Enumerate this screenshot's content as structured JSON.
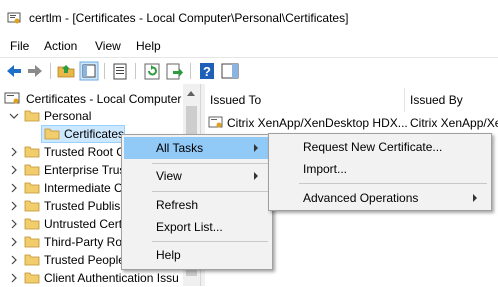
{
  "window": {
    "title": "certlm - [Certificates - Local Computer\\Personal\\Certificates]"
  },
  "menubar": {
    "items": [
      "File",
      "Action",
      "View",
      "Help"
    ]
  },
  "toolbar": {
    "buttons": [
      "back-icon",
      "forward-icon",
      "up-folder-icon",
      "show-hide-tree-icon",
      "properties-icon",
      "refresh-icon",
      "export-list-icon",
      "help-icon",
      "show-action-pane-icon"
    ]
  },
  "tree": {
    "root": "Certificates - Local Computer",
    "personal": "Personal",
    "certificates": "Certificates",
    "items": [
      "Trusted Root C",
      "Enterprise Trus",
      "Intermediate C",
      "Trusted Publis",
      "Untrusted Certi",
      "Third-Party Ro",
      "Trusted People",
      "Client Authentication Issu"
    ]
  },
  "list": {
    "columns": [
      "Issued To",
      "Issued By"
    ],
    "rows": [
      {
        "issued_to": "Citrix XenApp/XenDesktop HDX...",
        "issued_by": "Citrix XenApp/XenDesktop"
      }
    ]
  },
  "context_menu": {
    "items": [
      {
        "label": "All Tasks",
        "submenu": true,
        "highlighted": true
      },
      {
        "label": "View",
        "submenu": true
      },
      {
        "label": "Refresh"
      },
      {
        "label": "Export List..."
      },
      {
        "label": "Help"
      }
    ]
  },
  "submenu": {
    "items": [
      {
        "label": "Request New Certificate..."
      },
      {
        "label": "Import..."
      },
      {
        "label": "Advanced Operations",
        "submenu": true
      }
    ]
  },
  "colors": {
    "selection": "#cce8ff",
    "menu_highlight": "#91c9f7",
    "folder": "#e8b84a"
  }
}
